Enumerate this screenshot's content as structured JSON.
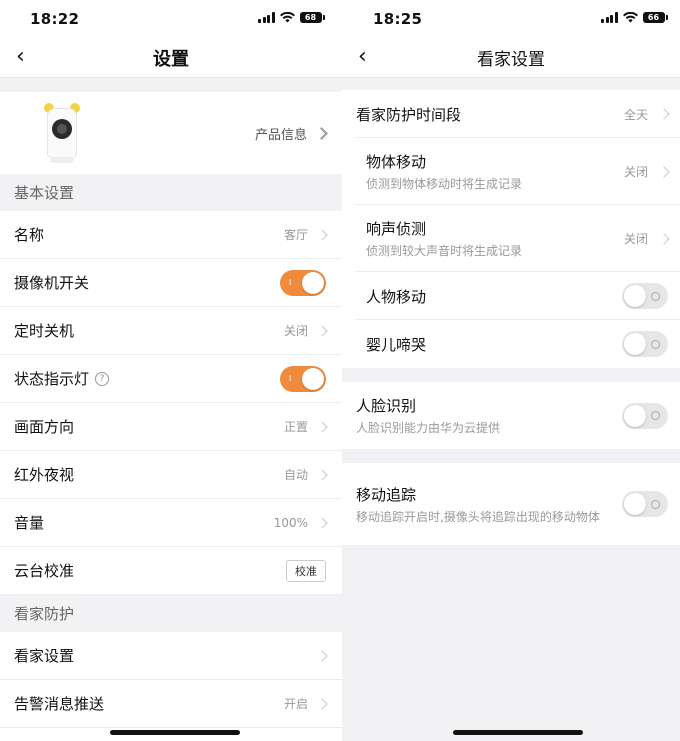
{
  "left": {
    "status": {
      "time": "18:22",
      "battery": "68"
    },
    "nav": {
      "back": "‹",
      "title": "设置"
    },
    "product": {
      "label": "产品信息"
    },
    "sections": {
      "basic": "基本设置",
      "guard": "看家防护"
    },
    "rows": {
      "name": {
        "label": "名称",
        "value": "客厅"
      },
      "camera_switch": {
        "label": "摄像机开关",
        "toggle": "on"
      },
      "timer_off": {
        "label": "定时关机",
        "value": "关闭"
      },
      "indicator": {
        "label": "状态指示灯",
        "help": "?",
        "toggle": "on"
      },
      "orientation": {
        "label": "画面方向",
        "value": "正置"
      },
      "night_vision": {
        "label": "红外夜视",
        "value": "自动"
      },
      "volume": {
        "label": "音量",
        "value": "100%"
      },
      "ptz": {
        "label": "云台校准",
        "button": "校准"
      },
      "home_settings": {
        "label": "看家设置"
      },
      "alert_push": {
        "label": "告警消息推送",
        "value": "开启"
      }
    }
  },
  "right": {
    "status": {
      "time": "18:25",
      "battery": "66"
    },
    "nav": {
      "back": "‹",
      "title": "看家设置"
    },
    "rows": {
      "period": {
        "label": "看家防护时间段",
        "value": "全天"
      },
      "motion": {
        "label": "物体移动",
        "desc": "侦测到物体移动时将生成记录",
        "value": "关闭"
      },
      "sound": {
        "label": "响声侦测",
        "desc": "侦测到较大声音时将生成记录",
        "value": "关闭"
      },
      "human": {
        "label": "人物移动",
        "toggle": "off"
      },
      "baby_cry": {
        "label": "婴儿啼哭",
        "toggle": "off"
      },
      "face": {
        "label": "人脸识别",
        "desc": "人脸识别能力由华为云提供",
        "toggle": "off"
      },
      "tracking": {
        "label": "移动追踪",
        "desc": "移动追踪开启时,摄像头将追踪出现的移动物体",
        "toggle": "off"
      }
    }
  },
  "colors": {
    "accent": "#f08a3c",
    "bg": "#f2f2f4"
  },
  "icons": {
    "back": "chevron-left-icon",
    "chevron": "chevron-right-icon",
    "help": "help-circle-icon"
  }
}
